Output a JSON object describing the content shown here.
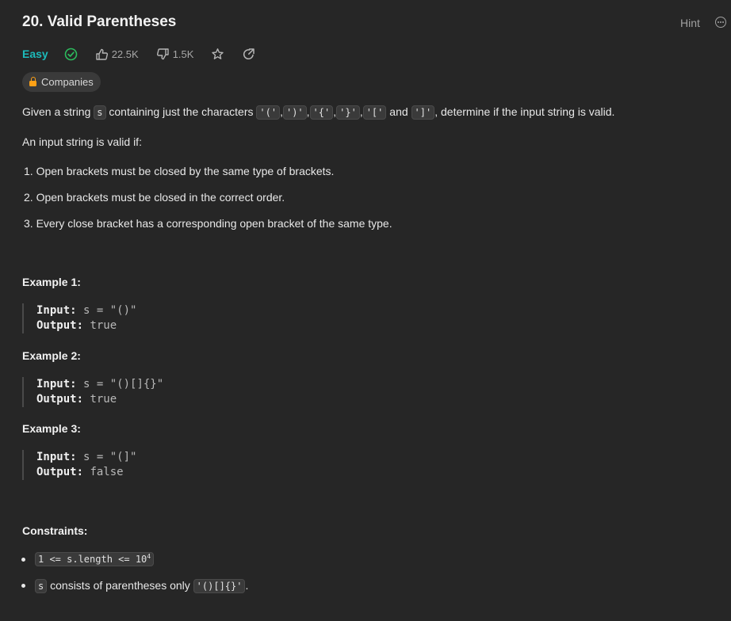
{
  "problem": {
    "title": "20. Valid Parentheses",
    "difficulty": "Easy",
    "likes": "22.5K",
    "dislikes": "1.5K",
    "hint_label": "Hint",
    "companies_label": "Companies"
  },
  "description": {
    "p1_before": "Given a string",
    "p1_var": "s",
    "p1_mid": "containing just the characters",
    "chars": [
      "'('",
      "')'",
      "'{'",
      "'}'",
      "'['",
      "']'"
    ],
    "p1_and": "and",
    "p1_after": ", determine if the input string is valid.",
    "p2": "An input string is valid if:",
    "rules": [
      "1. Open brackets must be closed by the same type of brackets.",
      "2. Open brackets must be closed in the correct order.",
      "3. Every close bracket has a corresponding open bracket of the same type."
    ]
  },
  "examples": [
    {
      "title": "Example 1:",
      "input_label": "Input:",
      "input": "s = \"()\"",
      "output_label": "Output:",
      "output": "true"
    },
    {
      "title": "Example 2:",
      "input_label": "Input:",
      "input": "s = \"()[]{}\"",
      "output_label": "Output:",
      "output": "true"
    },
    {
      "title": "Example 3:",
      "input_label": "Input:",
      "input": "s = \"(]\"",
      "output_label": "Output:",
      "output": "false"
    }
  ],
  "constraints": {
    "title": "Constraints:",
    "c1_code": "1 <= s.length <= 10",
    "c1_sup": "4",
    "c2_var": "s",
    "c2_text": "consists of parentheses only",
    "c2_code": "'()[]{}'",
    "c2_end": "."
  },
  "colors": {
    "background": "#262626",
    "easy": "#1cbaba",
    "lock": "#ffa116",
    "check": "#2cbb5d"
  },
  "icons": [
    "check-circle-icon",
    "thumbs-up-icon",
    "thumbs-down-icon",
    "star-icon",
    "share-icon",
    "lock-icon",
    "more-icon"
  ]
}
